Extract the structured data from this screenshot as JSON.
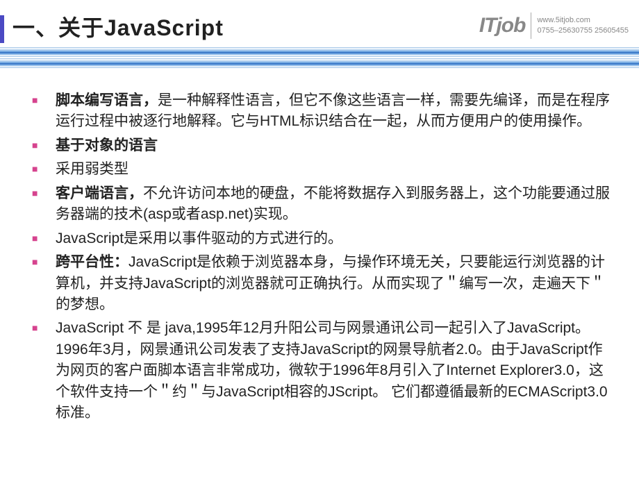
{
  "header": {
    "title": "一、关于JavaScript",
    "brand": "ITjob",
    "contact_url": "www.5itjob.com",
    "contact_phone": "0755–25630755 25605455"
  },
  "bullets": [
    {
      "lead": "脚本编写语言，",
      "rest": "是一种解释性语言，但它不像这些语言一样，需要先编译，而是在程序运行过程中被逐行地解释。它与HTML标识结合在一起，从而方便用户的使用操作。"
    },
    {
      "lead": "基于对象的语言",
      "rest": ""
    },
    {
      "lead": "",
      "rest": "采用弱类型"
    },
    {
      "lead": "客户端语言，",
      "rest": "不允许访问本地的硬盘，不能将数据存入到服务器上，这个功能要通过服务器端的技术(asp或者asp.net)实现。"
    },
    {
      "lead": "",
      "rest": "JavaScript是采用以事件驱动的方式进行的。"
    },
    {
      "lead": "跨平台性：",
      "rest": "JavaScript是依赖于浏览器本身，与操作环境无关，只要能运行浏览器的计算机，并支持JavaScript的浏览器就可正确执行。从而实现了＂编写一次，走遍天下＂的梦想。"
    },
    {
      "lead": "",
      "rest": "JavaScript 不 是 java,1995年12月升阳公司与网景通讯公司一起引入了JavaScript。1996年3月，网景通讯公司发表了支持JavaScript的网景导航者2.0。由于JavaScript作为网页的客户面脚本语言非常成功，微软于1996年8月引入了Internet  Explorer3.0，这个软件支持一个＂约＂与JavaScript相容的JScript。 它们都遵循最新的ECMAScript3.0标准。"
    }
  ]
}
